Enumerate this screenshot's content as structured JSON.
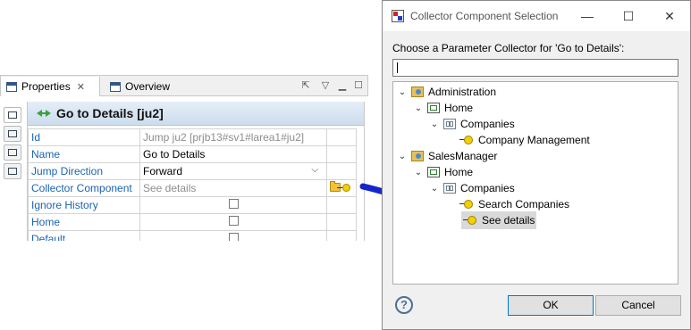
{
  "properties": {
    "tabs": [
      {
        "label": "Properties"
      },
      {
        "label": "Overview"
      }
    ],
    "header_title": "Go to Details [ju2]",
    "rows": [
      {
        "key": "Id",
        "value": "Jump ju2  [prjb13#sv1#larea1#ju2]"
      },
      {
        "key": "Name",
        "value": "Go to Details"
      },
      {
        "key": "Jump Direction",
        "value": "Forward"
      },
      {
        "key": "Collector Component",
        "value": "See details"
      },
      {
        "key": "Ignore History",
        "value": ""
      },
      {
        "key": "Home",
        "value": ""
      },
      {
        "key": "Default",
        "value": ""
      }
    ]
  },
  "dialog": {
    "title": "Collector Component Selection",
    "prompt": "Choose a Parameter Collector for 'Go to Details':",
    "filter_value": "",
    "tree": [
      {
        "label": "Administration"
      },
      {
        "label": "Home"
      },
      {
        "label": "Companies"
      },
      {
        "label": "Company Management"
      },
      {
        "label": "SalesManager"
      },
      {
        "label": "Home"
      },
      {
        "label": "Companies"
      },
      {
        "label": "Search Companies"
      },
      {
        "label": "See details"
      }
    ],
    "ok_label": "OK",
    "cancel_label": "Cancel"
  },
  "colors": {
    "key_text": "#1a64b4",
    "arrow": "#1526c8",
    "selection": "#d9d9d9"
  }
}
